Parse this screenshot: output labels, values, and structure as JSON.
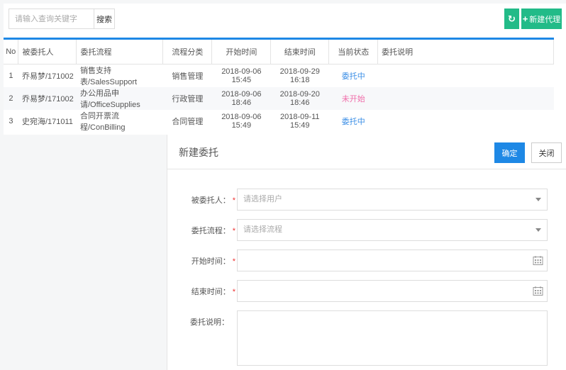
{
  "toolbar": {
    "search_placeholder": "请输入查询关键字",
    "search_label": "搜索",
    "refresh_icon": "refresh-icon",
    "new_label": "新建代理"
  },
  "table": {
    "headers": [
      "No",
      "被委托人",
      "委托流程",
      "流程分类",
      "开始时间",
      "结束时间",
      "当前状态",
      "委托说明"
    ],
    "rows": [
      {
        "no": "1",
        "person": "乔易梦/171002",
        "flow": "销售支持表/SalesSupport",
        "category": "销售管理",
        "start": "2018-09-06 15:45",
        "end": "2018-09-29 16:18",
        "status": "委托中",
        "status_color": "#3a8ee6",
        "note": ""
      },
      {
        "no": "2",
        "person": "乔易梦/171002",
        "flow": "办公用品申请/OfficeSupplies",
        "category": "行政管理",
        "start": "2018-09-06 18:46",
        "end": "2018-09-20 18:46",
        "status": "未开始",
        "status_color": "#f06eaa",
        "note": ""
      },
      {
        "no": "3",
        "person": "史宛海/171011",
        "flow": "合同开票流程/ConBilling",
        "category": "合同管理",
        "start": "2018-09-06 15:49",
        "end": "2018-09-11 15:49",
        "status": "委托中",
        "status_color": "#3a8ee6",
        "note": ""
      }
    ]
  },
  "dialog": {
    "title": "新建委托",
    "confirm": "确定",
    "close": "关闭",
    "fields": [
      {
        "label": "被委托人：",
        "placeholder": "请选择用户",
        "required": "*"
      },
      {
        "label": "委托流程：",
        "placeholder": "请选择流程",
        "required": "*"
      },
      {
        "label": "开始时间：",
        "placeholder": "",
        "required": "*"
      },
      {
        "label": "结束时间：",
        "placeholder": "",
        "required": "*"
      },
      {
        "label": "委托说明：",
        "placeholder": ""
      }
    ]
  }
}
